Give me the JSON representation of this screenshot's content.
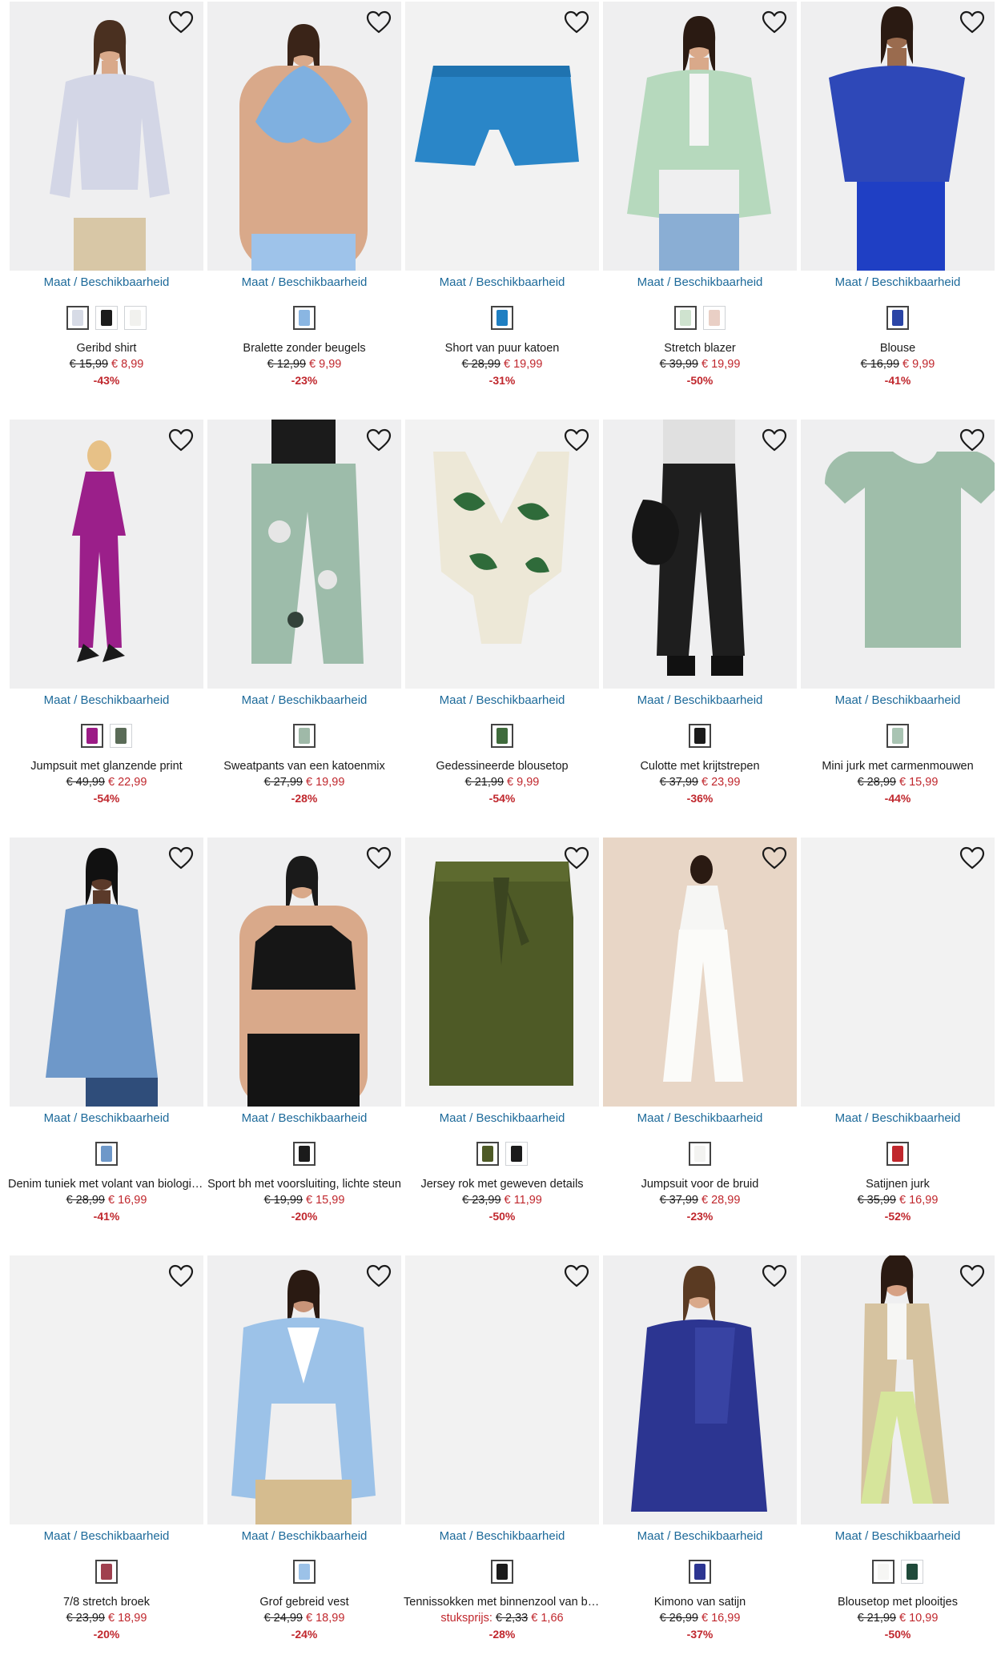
{
  "size_link_label": "Maat / Beschikbaarheid",
  "products": [
    {
      "title": "Geribd shirt",
      "old_price": "€ 15,99",
      "new_price": "€ 8,99",
      "discount": "-43%",
      "price_label": "",
      "image": "woman-lavender-ribbed-shirt",
      "bg": "#efeff0",
      "swatch_colors": [
        "#d7dbe6",
        "#1b1b1b",
        "#f1f1ee"
      ]
    },
    {
      "title": "Bralette zonder beugels",
      "old_price": "€ 12,99",
      "new_price": "€ 9,99",
      "discount": "-23%",
      "price_label": "",
      "image": "woman-blue-lace-bralette",
      "bg": "#efeff0",
      "swatch_colors": [
        "#8ab6e2"
      ]
    },
    {
      "title": "Short van puur katoen",
      "old_price": "€ 28,99",
      "new_price": "€ 19,99",
      "discount": "-31%",
      "price_label": "",
      "image": "blue-knit-shorts",
      "bg": "#f2f2f2",
      "swatch_colors": [
        "#1f7fc2"
      ]
    },
    {
      "title": "Stretch blazer",
      "old_price": "€ 39,99",
      "new_price": "€ 19,99",
      "discount": "-50%",
      "price_label": "",
      "image": "woman-mint-blazer",
      "bg": "#efeff0",
      "swatch_colors": [
        "#cfe3cf",
        "#e9cfc5"
      ]
    },
    {
      "title": "Blouse",
      "old_price": "€ 16,99",
      "new_price": "€ 9,99",
      "discount": "-41%",
      "price_label": "",
      "image": "woman-royal-blue-blouse",
      "bg": "#efeff0",
      "swatch_colors": [
        "#2b45a6"
      ]
    },
    {
      "title": "Jumpsuit met glanzende print",
      "old_price": "€ 49,99",
      "new_price": "€ 22,99",
      "discount": "-54%",
      "price_label": "",
      "image": "woman-magenta-jumpsuit",
      "bg": "#efeff0",
      "swatch_colors": [
        "#9c1b86",
        "#5a6b57"
      ]
    },
    {
      "title": "Sweatpants van een katoenmix",
      "old_price": "€ 27,99",
      "new_price": "€ 19,99",
      "discount": "-28%",
      "price_label": "",
      "image": "woman-printed-sweatpants",
      "bg": "#efeff0",
      "swatch_colors": [
        "#9fb9a8"
      ]
    },
    {
      "title": "Gedessineerde blousetop",
      "old_price": "€ 21,99",
      "new_price": "€ 9,99",
      "discount": "-54%",
      "price_label": "",
      "image": "green-leaf-print-top",
      "bg": "#f2f2f2",
      "swatch_colors": [
        "#3f6b3c"
      ]
    },
    {
      "title": "Culotte met krijtstrepen",
      "old_price": "€ 37,99",
      "new_price": "€ 23,99",
      "discount": "-36%",
      "price_label": "",
      "image": "woman-pinstripe-culottes",
      "bg": "#efeff0",
      "swatch_colors": [
        "#1b1b1b"
      ]
    },
    {
      "title": "Mini jurk met carmenmouwen",
      "old_price": "€ 28,99",
      "new_price": "€ 15,99",
      "discount": "-44%",
      "price_label": "",
      "image": "sage-mini-dress",
      "bg": "#efeff0",
      "swatch_colors": [
        "#a9c4b3"
      ]
    },
    {
      "title": "Denim tuniek met volant van biologisch katoen",
      "old_price": "€ 28,99",
      "new_price": "€ 16,99",
      "discount": "-41%",
      "price_label": "",
      "image": "woman-denim-tunic",
      "bg": "#efeff0",
      "swatch_colors": [
        "#6e98c9"
      ]
    },
    {
      "title": "Sport bh met voorsluiting, lichte steun",
      "old_price": "€ 19,99",
      "new_price": "€ 15,99",
      "discount": "-20%",
      "price_label": "",
      "image": "woman-black-sports-bra",
      "bg": "#efeff0",
      "swatch_colors": [
        "#1b1b1b"
      ]
    },
    {
      "title": "Jersey rok met geweven details",
      "old_price": "€ 23,99",
      "new_price": "€ 11,99",
      "discount": "-50%",
      "price_label": "",
      "image": "olive-paperbag-skirt",
      "bg": "#f2f2f2",
      "swatch_colors": [
        "#4e5a26",
        "#1b1b1b"
      ]
    },
    {
      "title": "Jumpsuit voor de bruid",
      "old_price": "€ 37,99",
      "new_price": "€ 28,99",
      "discount": "-23%",
      "price_label": "",
      "image": "woman-white-bridal-jumpsuit",
      "bg": "#e8d6c6",
      "swatch_colors": [
        "#f3f3f1"
      ]
    },
    {
      "title": "Satijnen jurk",
      "old_price": "€ 35,99",
      "new_price": "€ 16,99",
      "discount": "-52%",
      "price_label": "",
      "image": "blank-product-image",
      "bg": "#f2f2f2",
      "swatch_colors": [
        "#c0272d"
      ]
    },
    {
      "title": "7/8 stretch broek",
      "old_price": "€ 23,99",
      "new_price": "€ 18,99",
      "discount": "-20%",
      "price_label": "",
      "image": "blank-product-image",
      "bg": "#f2f2f2",
      "swatch_colors": [
        "#a0404f"
      ]
    },
    {
      "title": "Grof gebreid vest",
      "old_price": "€ 24,99",
      "new_price": "€ 18,99",
      "discount": "-24%",
      "price_label": "",
      "image": "woman-light-blue-cardigan",
      "bg": "#efeff0",
      "swatch_colors": [
        "#9cc2e8"
      ]
    },
    {
      "title": "Tennissokken met binnenzool van badstof",
      "old_price": "€ 2,33",
      "new_price": "€ 1,66",
      "discount": "-28%",
      "price_label": "stuksprijs:",
      "image": "blank-product-image",
      "bg": "#f2f2f2",
      "swatch_colors": [
        "#1b1b1b"
      ]
    },
    {
      "title": "Kimono van satijn",
      "old_price": "€ 26,99",
      "new_price": "€ 16,99",
      "discount": "-37%",
      "price_label": "",
      "image": "woman-blue-satin-kimono",
      "bg": "#efeff0",
      "swatch_colors": [
        "#2c3591"
      ]
    },
    {
      "title": "Blousetop met plooitjes",
      "old_price": "€ 21,99",
      "new_price": "€ 10,99",
      "discount": "-50%",
      "price_label": "",
      "image": "woman-trench-coat-green-pants",
      "bg": "#efeff0",
      "swatch_colors": [
        "#f6f6f4",
        "#1f4a3a"
      ]
    }
  ]
}
